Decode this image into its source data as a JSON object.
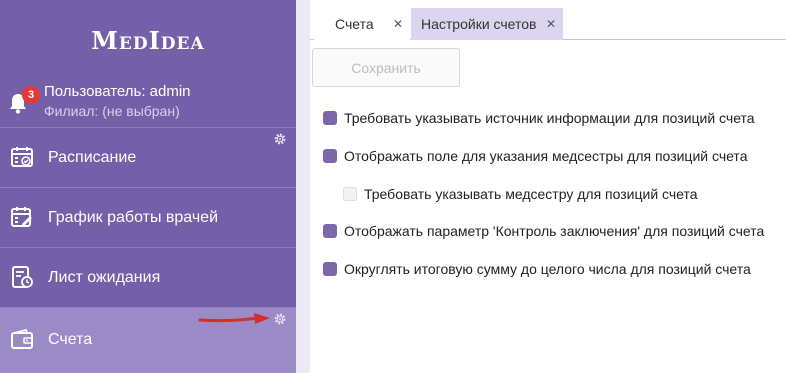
{
  "app": {
    "logo": "MedIdea"
  },
  "user": {
    "name_line": "Пользователь: admin",
    "branch_line": "Филиал: (не выбран)",
    "notifications": "3"
  },
  "sidebar": {
    "items": [
      {
        "label": "Расписание",
        "icon": "calendar-check-icon",
        "active": false
      },
      {
        "label": "График работы врачей",
        "icon": "schedule-edit-icon",
        "active": false
      },
      {
        "label": "Лист ожидания",
        "icon": "waitlist-clock-icon",
        "active": false
      },
      {
        "label": "Счета",
        "icon": "wallet-icon",
        "active": true
      }
    ]
  },
  "tabs": [
    {
      "label": "Счета",
      "close": "✕",
      "active": false
    },
    {
      "label": "Настройки счетов",
      "close": "✕",
      "active": true
    }
  ],
  "toolbar": {
    "save_label": "Сохранить",
    "save_enabled": false
  },
  "options": [
    {
      "label": "Требовать указывать источник информации для позиций счета",
      "checked": true
    },
    {
      "label": "Отображать поле для указания медсестры для позиций счета",
      "checked": true
    },
    {
      "label": "Требовать указывать медсестру для позиций счета",
      "checked": false
    },
    {
      "label": "Отображать параметр 'Контроль заключения' для позиций счета",
      "checked": true
    },
    {
      "label": "Округлять итоговую сумму до целого числа для позиций счета",
      "checked": true
    }
  ],
  "colors": {
    "sidebar": "#7460a8",
    "active_item": "#9a8bc6",
    "checkbox": "#7a68aa",
    "badge": "#e53935",
    "annotation_arrow": "#d32f2f"
  }
}
